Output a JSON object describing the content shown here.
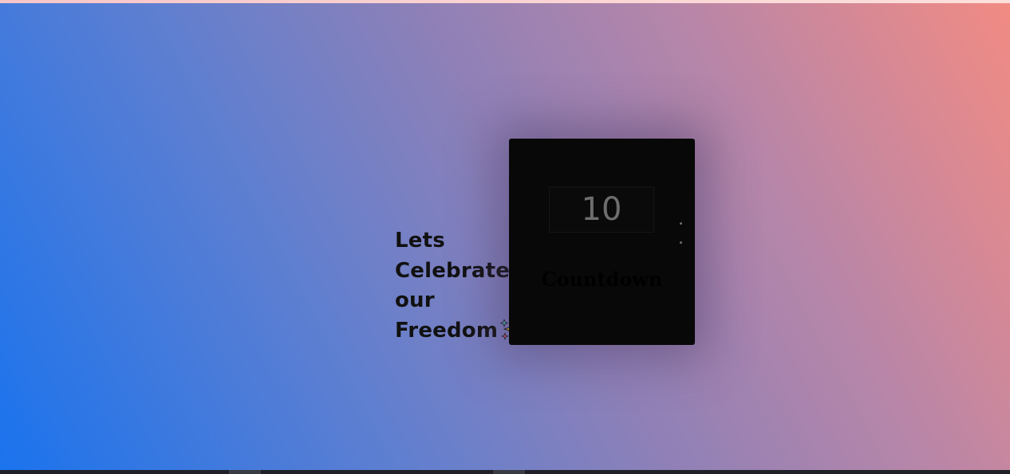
{
  "headline": {
    "lines": [
      "Lets",
      "Celebrate",
      "our",
      "Freedom"
    ],
    "emoji_icon": "sparkles-icon"
  },
  "countdown": {
    "value": "10",
    "label": "Countdown",
    "separator_icon": "colon-dots-icon"
  },
  "colors": {
    "gradient_start": "#1a73ee",
    "gradient_mid": "#8c80b8",
    "gradient_end": "#f28b83",
    "card_background": "#080808",
    "number_color": "#6e6e6e"
  }
}
